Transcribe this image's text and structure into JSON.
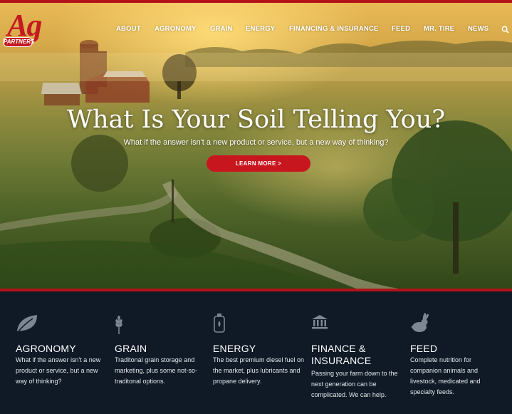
{
  "logo": {
    "mark": "Ag",
    "subtitle": "PARTNERS"
  },
  "nav": {
    "items": [
      "ABOUT",
      "AGRONOMY",
      "GRAIN",
      "ENERGY",
      "FINANCING & INSURANCE",
      "FEED",
      "MR. TIRE",
      "NEWS"
    ],
    "search_icon": "search-icon"
  },
  "hero": {
    "title": "What Is Your Soil Telling You?",
    "subtitle": "What if the answer isn't a new product or service, but a new way of thinking?",
    "cta": "LEARN MORE >"
  },
  "services": [
    {
      "icon": "leaf-icon",
      "title": "AGRONOMY",
      "desc": "What if the answer isn't a new product or service, but a new way of thinking?"
    },
    {
      "icon": "wheat-icon",
      "title": "GRAIN",
      "desc": "Traditonal grain storage and marketing, plus some not-so-traditonal options."
    },
    {
      "icon": "fuel-can-icon",
      "title": "ENERGY",
      "desc": "The best premium diesel fuel on the market, plus lubricants and propane delivery."
    },
    {
      "icon": "bank-icon",
      "title": "FINANCE & INSURANCE",
      "desc": "Passing your farm down to the next generation can be complicated. We can help."
    },
    {
      "icon": "rabbit-icon",
      "title": "FEED",
      "desc": "Complete nutrition for companion animals and livestock, medicated and specialty feeds."
    }
  ],
  "colors": {
    "brand_red": "#c41a22",
    "footer_bg": "#0f1a26",
    "text": "#ffffff"
  }
}
